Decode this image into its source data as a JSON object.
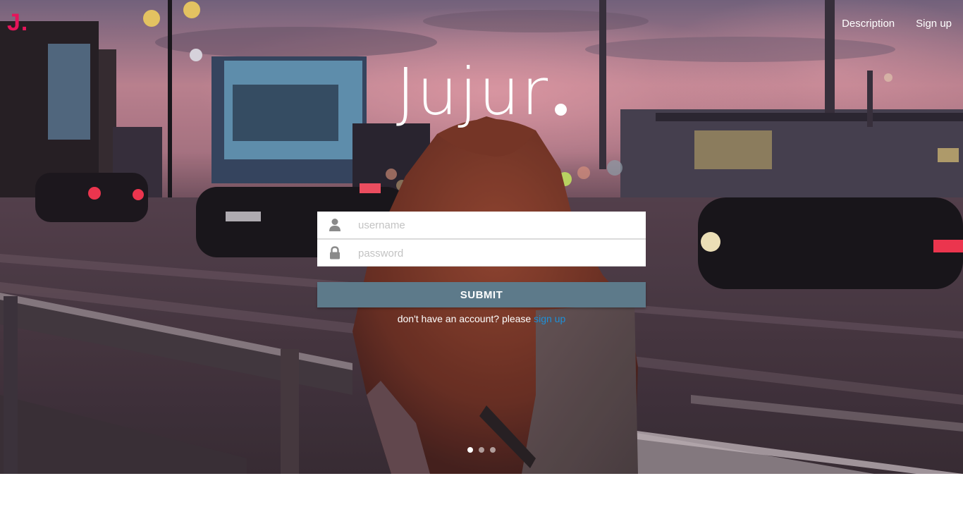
{
  "brand": {
    "logo_text": "J.",
    "title": "Jujur",
    "accent_color": "#e6145a"
  },
  "nav": {
    "items": [
      {
        "label": "Description"
      },
      {
        "label": "Sign up"
      }
    ]
  },
  "login": {
    "username": {
      "placeholder": "username",
      "value": "",
      "icon": "user-icon"
    },
    "password": {
      "placeholder": "password",
      "value": "",
      "icon": "lock-icon"
    },
    "submit_label": "SUBMIT",
    "submit_color": "#5d7a8a",
    "signup_prompt": "don't have an account? please",
    "signup_link": "sign up",
    "link_color": "#1e90d8"
  },
  "carousel": {
    "slides": 3,
    "active_index": 0
  }
}
